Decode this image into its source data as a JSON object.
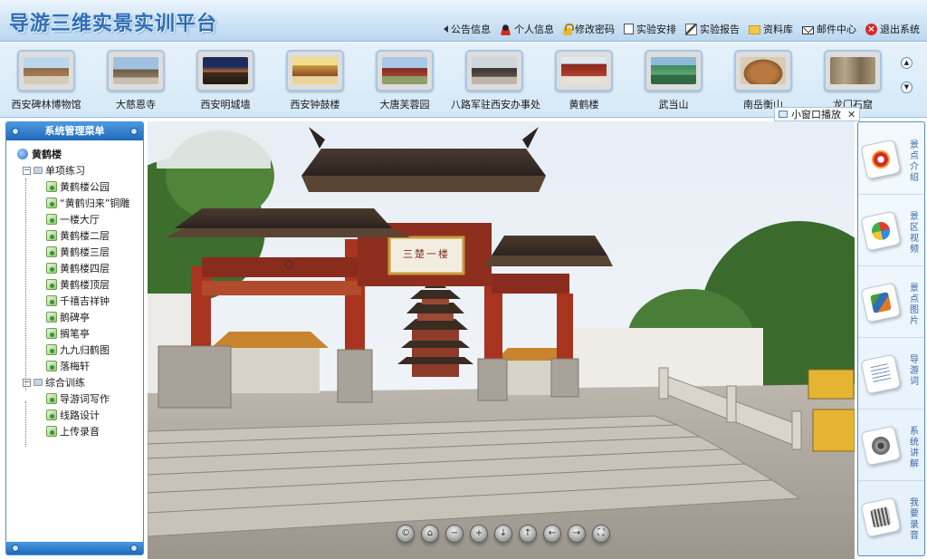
{
  "header": {
    "title": "导游三维实景实训平台",
    "nav": [
      {
        "label": "公告信息",
        "icon": "speaker-icon"
      },
      {
        "label": "个人信息",
        "icon": "person-icon"
      },
      {
        "label": "修改密码",
        "icon": "lock-icon"
      },
      {
        "label": "实验安排",
        "icon": "clipboard-icon"
      },
      {
        "label": "实验报告",
        "icon": "pencil-icon"
      },
      {
        "label": "资料库",
        "icon": "folder-icon"
      },
      {
        "label": "邮件中心",
        "icon": "mail-icon"
      },
      {
        "label": "退出系统",
        "icon": "exit-icon"
      }
    ]
  },
  "scenic_spots": [
    {
      "label": "西安碑林博物馆"
    },
    {
      "label": "大慈恩寺"
    },
    {
      "label": "西安明城墙"
    },
    {
      "label": "西安钟鼓楼"
    },
    {
      "label": "大唐芙蓉园"
    },
    {
      "label": "八路军驻西安办事处"
    },
    {
      "label": "黄鹤楼"
    },
    {
      "label": "武当山"
    },
    {
      "label": "南岳衡山"
    },
    {
      "label": "龙门石窟"
    }
  ],
  "sidebar": {
    "header": "系统管理菜单",
    "root": "黄鹤楼",
    "groups": [
      {
        "label": "单项练习",
        "items": [
          "黄鹤楼公园",
          "“黄鹤归来”铜雕",
          "一楼大厅",
          "黄鹤楼二层",
          "黄鹤楼三层",
          "黄鹤楼四层",
          "黄鹤楼顶层",
          "千禧吉祥钟",
          "鹅碑亭",
          "搁笔亭",
          "九九归鹤图",
          "落梅轩"
        ]
      },
      {
        "label": "综合训练",
        "items": [
          "导游词写作",
          "线路设计",
          "上传录音"
        ]
      }
    ]
  },
  "pano": {
    "gate_plaque": "三楚一楼",
    "small_window_label": "小窗口播放",
    "controls": [
      "©",
      "⌂",
      "−",
      "+",
      "↓",
      "↑",
      "←",
      "→",
      "⛶"
    ]
  },
  "right_panel": [
    {
      "label": "景点介绍",
      "icon": "intro-icon"
    },
    {
      "label": "景区视频",
      "icon": "video-icon"
    },
    {
      "label": "景点图片",
      "icon": "picture-icon"
    },
    {
      "label": "导游词",
      "icon": "script-icon"
    },
    {
      "label": "系统讲解",
      "icon": "audio-explain-icon"
    },
    {
      "label": "我要录音",
      "icon": "record-icon"
    }
  ],
  "colors": {
    "accent": "#2d6fb8",
    "panel_border": "#4f8ec9",
    "sidebar_header": "#1f69b8"
  }
}
